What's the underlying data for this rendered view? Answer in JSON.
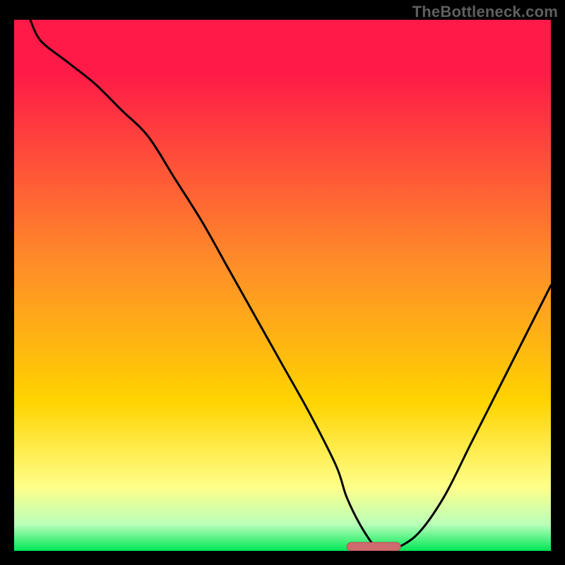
{
  "watermark": "TheBottleneck.com",
  "colors": {
    "frame": "#000000",
    "curve": "#000000",
    "marker_fill": "#cf6b6f",
    "marker_stroke": "#b94d52",
    "grad_top": "#ff1a47",
    "grad_mid_upper": "#ff8a2a",
    "grad_mid": "#ffd400",
    "grad_yellow_pale": "#ffff8a",
    "grad_green_pale": "#b9ffb9",
    "grad_green": "#00e756"
  },
  "chart_data": {
    "type": "line",
    "title": "",
    "xlabel": "",
    "ylabel": "",
    "xlim": [
      0,
      100
    ],
    "ylim": [
      0,
      100
    ],
    "x": [
      0,
      5,
      10,
      15,
      20,
      25,
      30,
      35,
      40,
      45,
      50,
      55,
      60,
      62,
      65,
      68,
      70,
      75,
      80,
      85,
      90,
      95,
      100
    ],
    "y": [
      100,
      96,
      92,
      88,
      83,
      78,
      70,
      62,
      53,
      44,
      35,
      26,
      16,
      10,
      4,
      0,
      0,
      3,
      10,
      20,
      30,
      40,
      50
    ],
    "optimum_band": {
      "x_start": 62,
      "x_end": 72,
      "y": 0
    },
    "curve_enters_from_top_at_x": 3
  }
}
